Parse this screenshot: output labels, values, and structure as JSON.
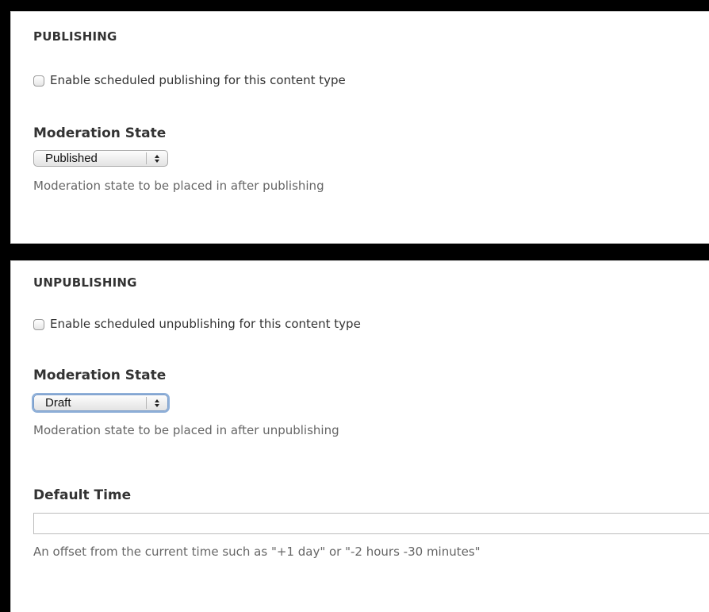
{
  "publishing": {
    "title": "PUBLISHING",
    "checkbox_label": "Enable scheduled publishing for this content type",
    "checkbox_checked": false,
    "moderation_label": "Moderation State",
    "moderation_value": "Published",
    "moderation_description": "Moderation state to be placed in after publishing"
  },
  "unpublishing": {
    "title": "UNPUBLISHING",
    "checkbox_label": "Enable scheduled unpublishing for this content type",
    "checkbox_checked": false,
    "moderation_label": "Moderation State",
    "moderation_value": "Draft",
    "moderation_description": "Moderation state to be placed in after unpublishing",
    "default_time_label": "Default Time",
    "default_time_value": "",
    "default_time_description": "An offset from the current time such as \"+1 day\" or \"-2 hours -30 minutes\""
  },
  "colors": {
    "background": "#000000",
    "panel": "#ffffff",
    "panel_border": "#cfcfcf",
    "text": "#333333",
    "description_text": "#666666",
    "focus_ring": "#8fb0d9"
  },
  "icons": [
    "checkbox-icon",
    "select-arrows-icon"
  ]
}
